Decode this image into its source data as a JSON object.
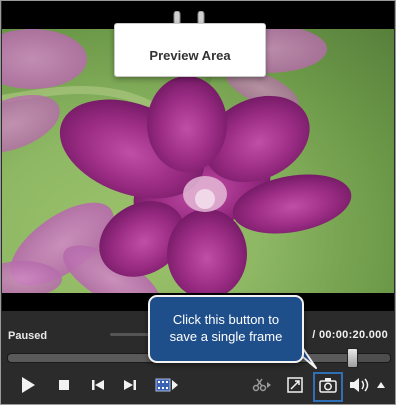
{
  "preview": {
    "label": "Preview Area"
  },
  "status": {
    "state": "Paused",
    "time": "/ 00:00:20.000"
  },
  "timeline": {
    "position_fraction": 0.9
  },
  "callout": {
    "line1": "Click this button to",
    "line2": "save a single frame"
  },
  "toolbar": {
    "buttons": [
      {
        "name": "play-button",
        "icon": "play-icon"
      },
      {
        "name": "stop-button",
        "icon": "stop-icon"
      },
      {
        "name": "previous-frame-button",
        "icon": "skip-back-icon"
      },
      {
        "name": "next-frame-button",
        "icon": "skip-forward-icon"
      },
      {
        "name": "split-clip-button",
        "icon": "film-strip-icon"
      },
      {
        "name": "cut-button",
        "icon": "scissors-icon"
      },
      {
        "name": "fullscreen-button",
        "icon": "expand-icon"
      },
      {
        "name": "snapshot-button",
        "icon": "camera-icon"
      },
      {
        "name": "volume-button",
        "icon": "speaker-icon"
      },
      {
        "name": "volume-menu-button",
        "icon": "triangle-up-icon"
      }
    ]
  },
  "colors": {
    "accent": "#1f4f8a",
    "highlight": "#2f6fb5"
  }
}
